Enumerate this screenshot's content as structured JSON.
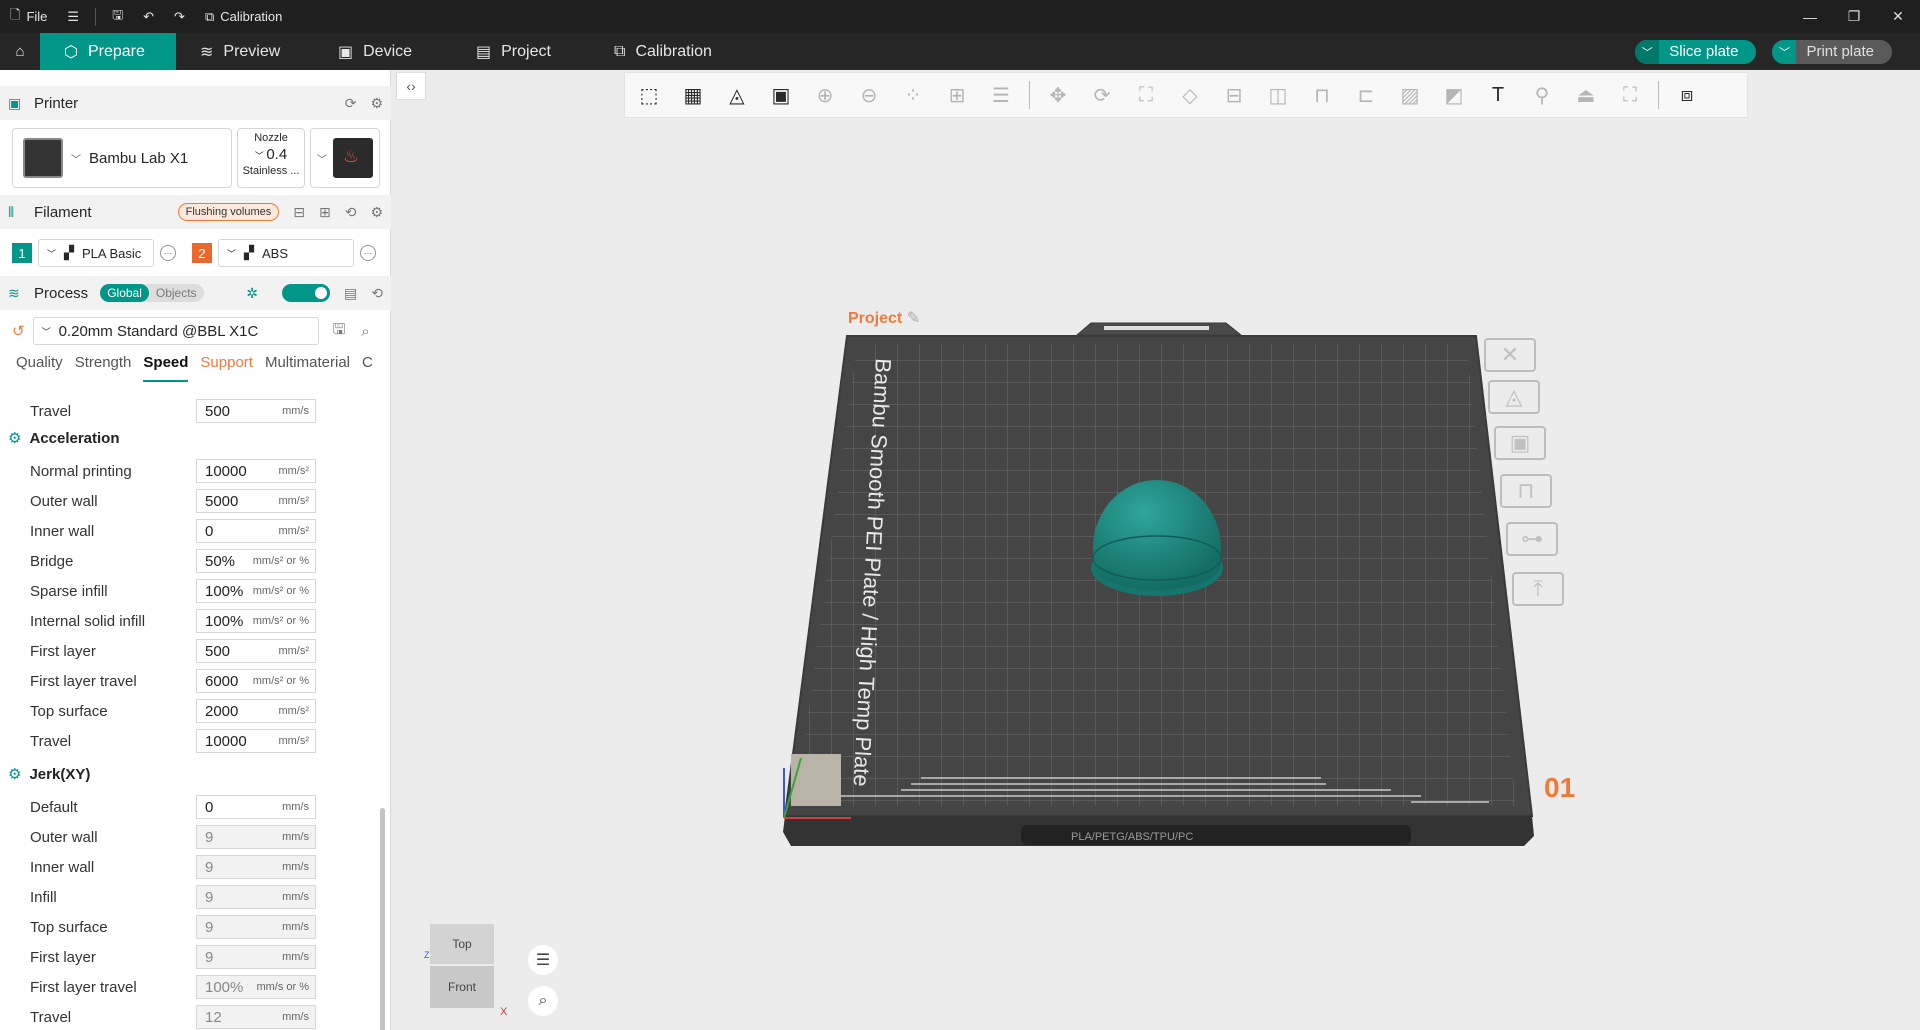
{
  "titlebar": {
    "file_label": "File",
    "calibration_label": "Calibration",
    "minimize": "—",
    "restore": "❐",
    "close": "✕"
  },
  "tabs": {
    "items": [
      {
        "label": "Prepare",
        "icon": "cube-icon"
      },
      {
        "label": "Preview",
        "icon": "layers-icon"
      },
      {
        "label": "Device",
        "icon": "device-icon"
      },
      {
        "label": "Project",
        "icon": "list-icon"
      },
      {
        "label": "Calibration",
        "icon": "calibration-icon"
      }
    ],
    "slice_label": "Slice plate",
    "print_label": "Print plate"
  },
  "printer": {
    "section_title": "Printer",
    "name": "Bambu Lab X1",
    "nozzle_label": "Nozzle",
    "nozzle_value": "0.4",
    "nozzle_material": "Stainless ..."
  },
  "filament": {
    "section_title": "Filament",
    "flush_label": "Flushing volumes",
    "items": [
      {
        "num": "1",
        "name": "PLA Basic",
        "color": "#009688"
      },
      {
        "num": "2",
        "name": "ABS",
        "color": "#e9692c"
      }
    ]
  },
  "process": {
    "section_title": "Process",
    "global_label": "Global",
    "objects_label": "Objects",
    "preset": "0.20mm Standard @BBL X1C",
    "subtabs": [
      "Quality",
      "Strength",
      "Speed",
      "Support",
      "Multimaterial",
      "C"
    ],
    "active_subtab": "Speed"
  },
  "settings": {
    "top_travel": {
      "label": "Travel",
      "value": "500",
      "unit": "mm/s"
    },
    "acceleration": {
      "title": "Acceleration",
      "rows": [
        {
          "label": "Normal printing",
          "value": "10000",
          "unit": "mm/s²",
          "disabled": false
        },
        {
          "label": "Outer wall",
          "value": "5000",
          "unit": "mm/s²",
          "disabled": false
        },
        {
          "label": "Inner wall",
          "value": "0",
          "unit": "mm/s²",
          "disabled": false
        },
        {
          "label": "Bridge",
          "value": "50%",
          "unit": "mm/s² or %",
          "disabled": false
        },
        {
          "label": "Sparse infill",
          "value": "100%",
          "unit": "mm/s² or %",
          "disabled": false
        },
        {
          "label": "Internal solid infill",
          "value": "100%",
          "unit": "mm/s² or %",
          "disabled": false
        },
        {
          "label": "First layer",
          "value": "500",
          "unit": "mm/s²",
          "disabled": false
        },
        {
          "label": "First layer travel",
          "value": "6000",
          "unit": "mm/s² or %",
          "disabled": false
        },
        {
          "label": "Top surface",
          "value": "2000",
          "unit": "mm/s²",
          "disabled": false
        },
        {
          "label": "Travel",
          "value": "10000",
          "unit": "mm/s²",
          "disabled": false
        }
      ]
    },
    "jerk": {
      "title": "Jerk(XY)",
      "rows": [
        {
          "label": "Default",
          "value": "0",
          "unit": "mm/s",
          "disabled": false
        },
        {
          "label": "Outer wall",
          "value": "9",
          "unit": "mm/s",
          "disabled": true
        },
        {
          "label": "Inner wall",
          "value": "9",
          "unit": "mm/s",
          "disabled": true
        },
        {
          "label": "Infill",
          "value": "9",
          "unit": "mm/s",
          "disabled": true
        },
        {
          "label": "Top surface",
          "value": "9",
          "unit": "mm/s",
          "disabled": true
        },
        {
          "label": "First layer",
          "value": "9",
          "unit": "mm/s",
          "disabled": true
        },
        {
          "label": "First layer travel",
          "value": "100%",
          "unit": "mm/s or %",
          "disabled": true
        },
        {
          "label": "Travel",
          "value": "12",
          "unit": "mm/s",
          "disabled": true
        }
      ]
    }
  },
  "scene": {
    "project_label": "Project",
    "plate_text": "Bambu Smooth PEI Plate / High Temp Plate",
    "plate_bottom_text": "PLA/PETG/ABS/TPU/PC",
    "plate_number": "01",
    "model_color": "#1f8a80",
    "cube_top": "Top",
    "cube_front": "Front",
    "axis_x": "X",
    "axis_z": "Z"
  }
}
